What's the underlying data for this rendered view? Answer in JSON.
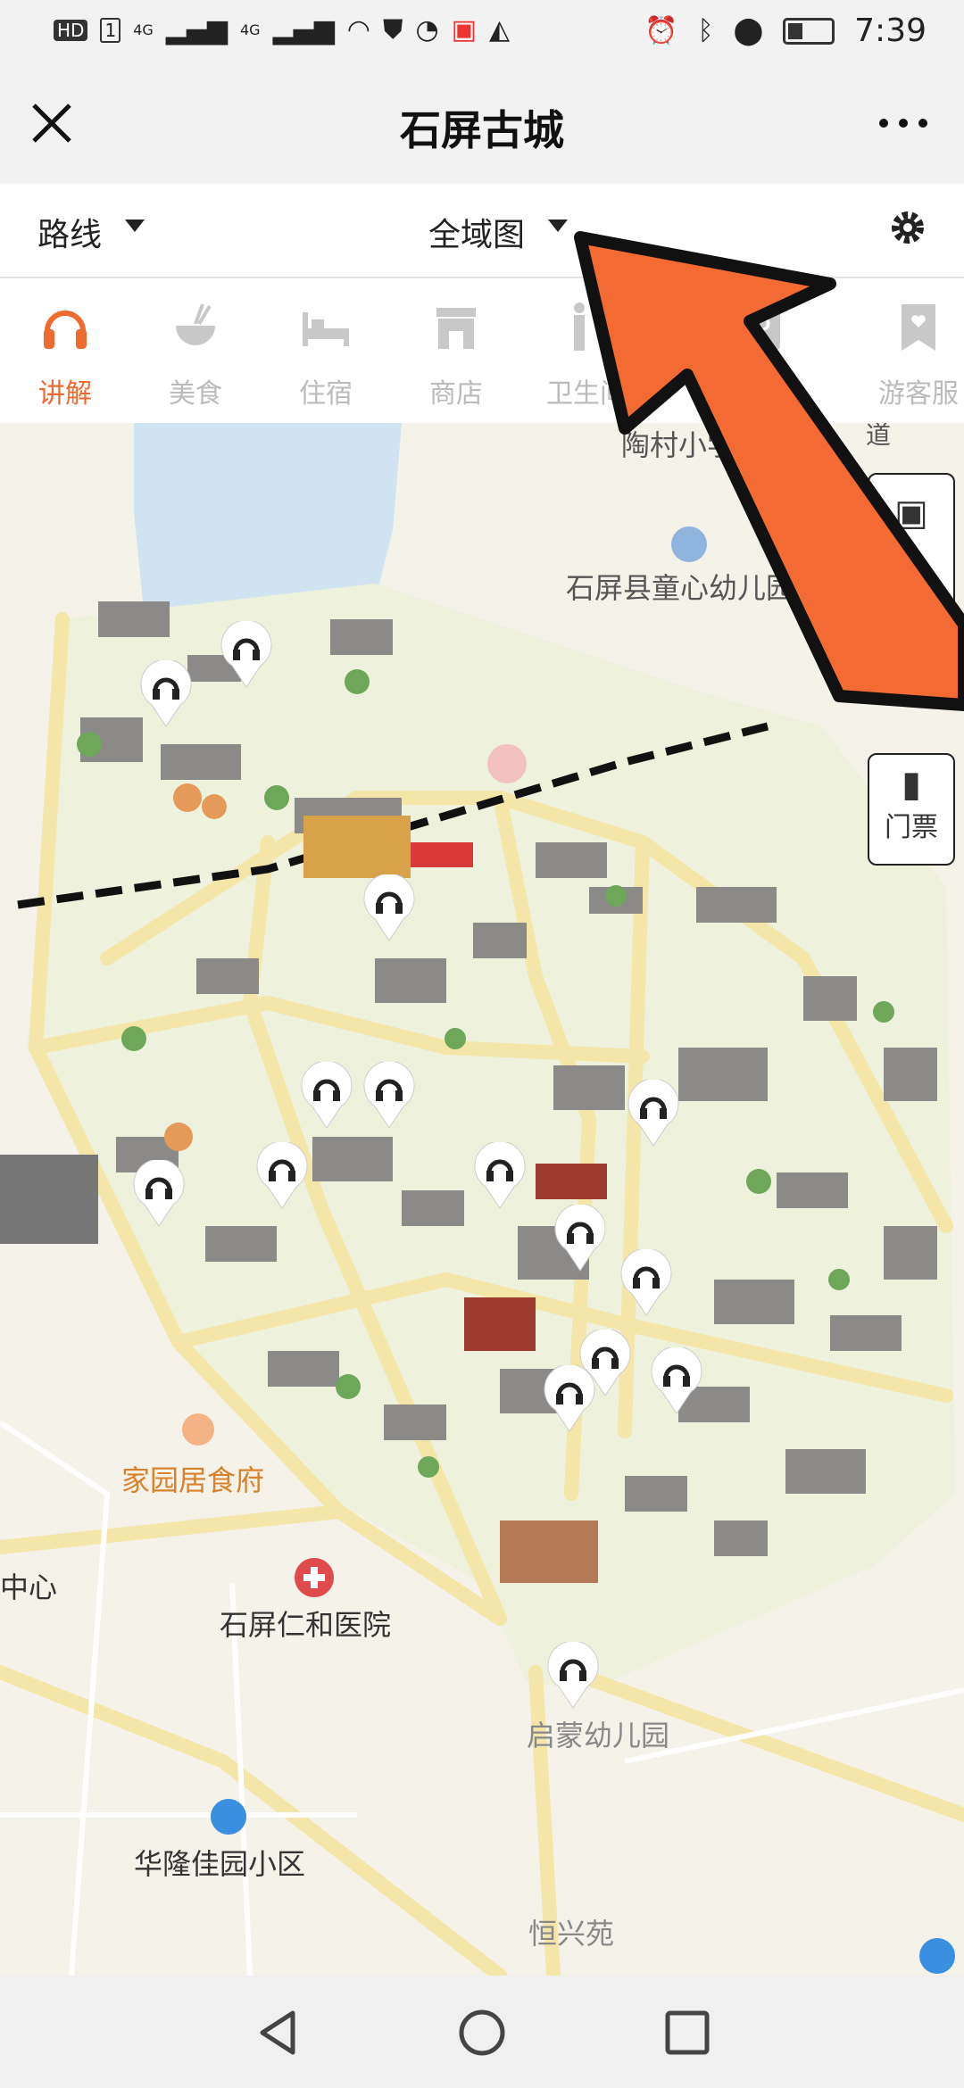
{
  "status": {
    "left_badges": [
      "HD",
      "1",
      "4G",
      "4G"
    ],
    "time": "7:39"
  },
  "titlebar": {
    "title": "石屏古城"
  },
  "filters": {
    "route_label": "路线",
    "map_label": "全域图"
  },
  "categories": [
    {
      "label": "讲解",
      "icon": "headphones-icon",
      "active": true
    },
    {
      "label": "美食",
      "icon": "food-bowl-icon",
      "active": false
    },
    {
      "label": "住宿",
      "icon": "bed-icon",
      "active": false
    },
    {
      "label": "商店",
      "icon": "shop-icon",
      "active": false
    },
    {
      "label": "卫生间",
      "icon": "restroom-icon",
      "active": false
    },
    {
      "label": "游客服",
      "icon": "visitor-service-icon",
      "active": false
    }
  ],
  "map": {
    "labels": {
      "school1": "陶村小学",
      "kindergarten": "石屏县童心幼儿园",
      "restaurant": "家园居食府",
      "hospital": "石屏仁和医院",
      "center": "中心",
      "kindergarten2": "启蒙幼儿园",
      "community": "华隆佳园小区",
      "hengxing": "恒兴苑",
      "road": "道"
    },
    "side_buttons": {
      "panorama": "全景",
      "tickets": "门票"
    }
  },
  "colors": {
    "accent": "#ef6a2e",
    "arrow": "#f36a33",
    "road": "#f3e6a8",
    "map_bg": "#f5f2ea"
  }
}
